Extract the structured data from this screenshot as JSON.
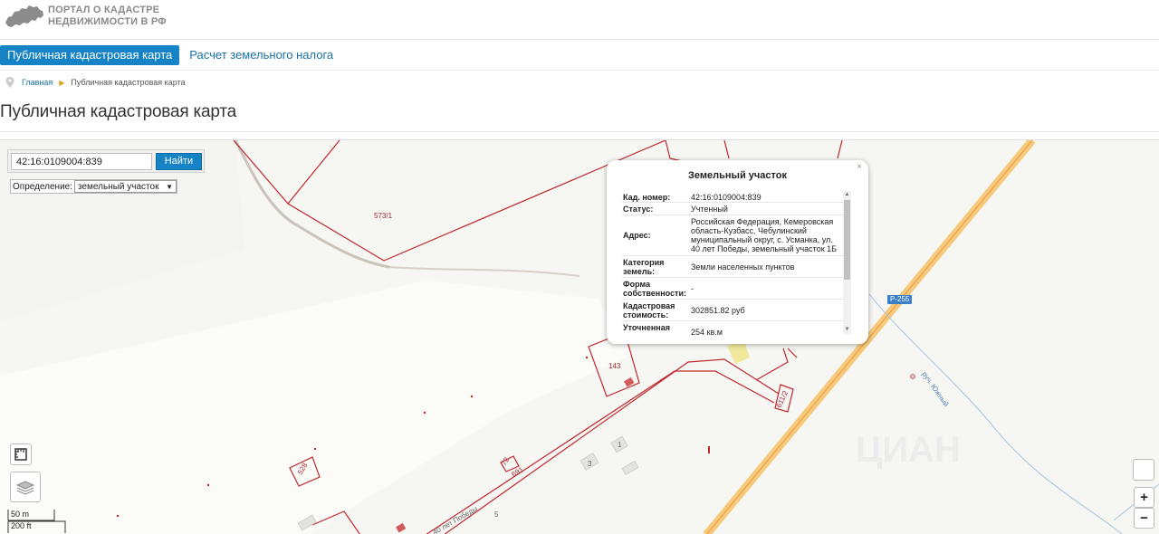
{
  "header": {
    "logo_line1": "ПОРТАЛ О КАДАСТРЕ",
    "logo_line2": "НЕДВИЖИМОСТИ В РФ"
  },
  "nav": {
    "items": [
      {
        "label": "Публичная кадастровая карта",
        "active": true
      },
      {
        "label": "Расчет земельного налога",
        "active": false
      }
    ]
  },
  "breadcrumb": {
    "home": "Главная",
    "current": "Публичная кадастровая карта"
  },
  "page_title": "Публичная кадастровая карта",
  "search": {
    "value": "42:16:0109004:839",
    "button": "Найти",
    "definition_label": "Определение:",
    "definition_value": "земельный участок"
  },
  "map_labels": {
    "parcel_573": "573/1",
    "parcel_143": "143",
    "parcel_611": "611/2",
    "parcel_528": "528",
    "parcel_691": "691",
    "parcel_72": "72",
    "house_1": "1",
    "house_3": "3",
    "house_5": "5",
    "street": "40 лет Победы",
    "stream": "руч. Южный",
    "road": "Р-255",
    "watermark": "ЦИАН"
  },
  "scale": {
    "metric": "50 m",
    "imperial": "200 ft"
  },
  "zoom": {
    "in": "+",
    "out": "−"
  },
  "popup": {
    "title": "Земельный участок",
    "close": "×",
    "rows": [
      {
        "key": "Кад. номер:",
        "value": "42:16:0109004:839"
      },
      {
        "key": "Статус:",
        "value": "Учтенный"
      },
      {
        "key": "Адрес:",
        "value": "Российская Федерация, Кемеровская область-Кузбасс, Чебулинский муниципальный округ, с. Усманка, ул. 40 лет Победы, земельный участок 1Б"
      },
      {
        "key": "Категория земель:",
        "value": "Земли населенных пунктов"
      },
      {
        "key": "Форма собственности:",
        "value": "-"
      },
      {
        "key": "Кадастровая стоимость:",
        "value": "302851.82 руб"
      },
      {
        "key": "Уточненная площадь:",
        "value": "254 кв.м"
      }
    ]
  },
  "colors": {
    "accent": "#1583c6",
    "parcel_line": "#c0282d",
    "road": "#f7c97a"
  }
}
